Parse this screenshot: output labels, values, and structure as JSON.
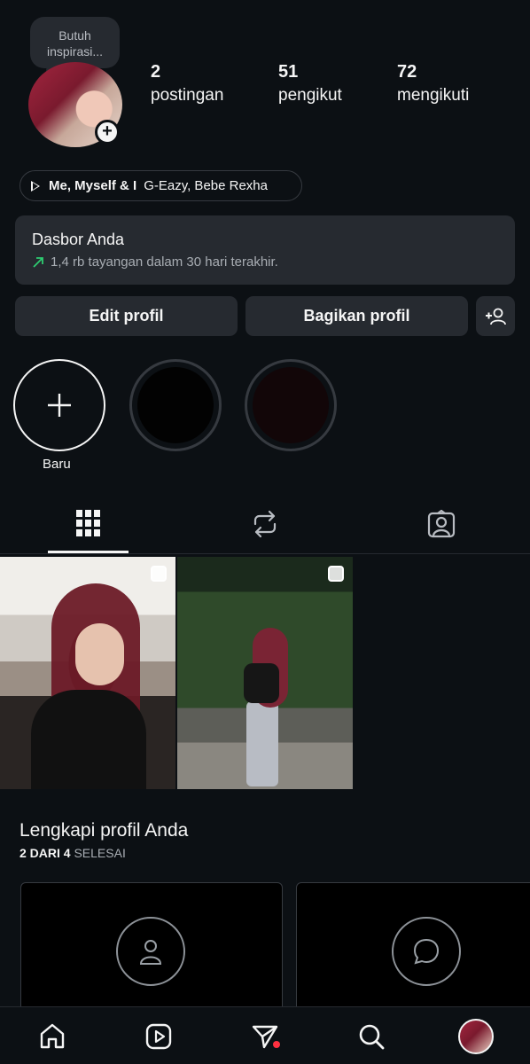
{
  "profile": {
    "note": "Butuh inspirasi...",
    "stats": [
      {
        "value": "2",
        "label": "postingan"
      },
      {
        "value": "51",
        "label": "pengikut"
      },
      {
        "value": "72",
        "label": "mengikuti"
      }
    ],
    "music": {
      "song": "Me, Myself & I",
      "artist": "G-Eazy, Bebe Rexha"
    }
  },
  "dashboard": {
    "title": "Dasbor Anda",
    "subtitle": "1,4 rb tayangan dalam 30 hari terakhir."
  },
  "actions": {
    "edit_label": "Edit profil",
    "share_label": "Bagikan profil"
  },
  "highlights": {
    "new_label": "Baru"
  },
  "tabs": [
    "grid-icon",
    "reposts-icon",
    "tagged-icon"
  ],
  "complete_profile": {
    "title": "Lengkapi profil Anda",
    "progress": "2 DARI 4",
    "status": "SELESAI"
  },
  "nav": [
    "home-icon",
    "reels-icon",
    "direct-icon",
    "search-icon",
    "profile-avatar"
  ],
  "colors": {
    "background": "#0c1014",
    "surface": "#262a30",
    "accent_green": "#2ecc71",
    "notification_red": "#ff3040"
  }
}
